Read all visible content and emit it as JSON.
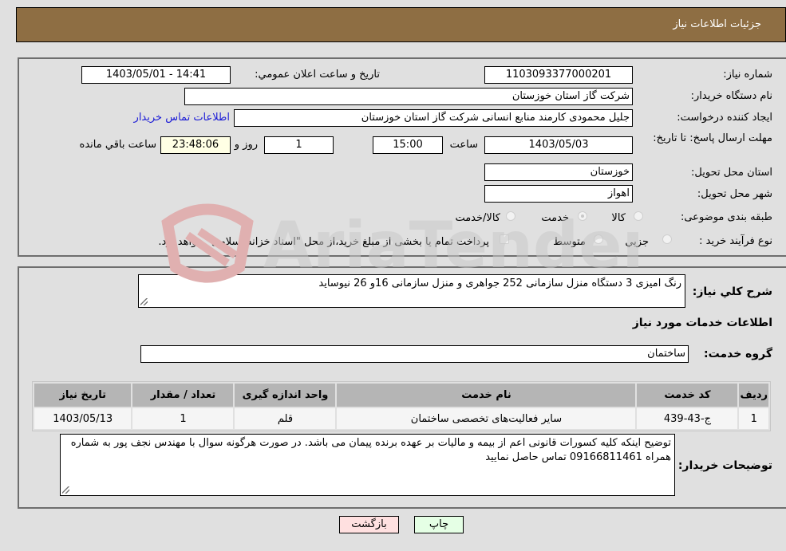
{
  "header": {
    "title": "جزئیات اطلاعات نیاز"
  },
  "form": {
    "need_number_label": "شماره نیاز:",
    "need_number": "1103093377000201",
    "announce_label": "تاریخ و ساعت اعلان عمومي:",
    "announce_value": "1403/05/01 - 14:41",
    "buyer_org_label": "نام دستگاه خریدار:",
    "buyer_org": "شرکت گاز استان خوزستان",
    "requester_label": "ایجاد کننده درخواست:",
    "requester": "جلیل محمودی کارمند منابع انسانی شرکت گاز استان خوزستان",
    "buyer_contact_link": "اطلاعات تماس خریدار",
    "deadline_label": "مهلت ارسال پاسخ: تا تاریخ:",
    "deadline_date": "1403/05/03",
    "time_label": "ساعت",
    "deadline_time": "15:00",
    "days_value": "1",
    "days_label": "روز و",
    "remaining_time": "23:48:06",
    "remaining_label": "ساعت باقي مانده",
    "province_label": "استان محل تحویل:",
    "province": "خوزستان",
    "city_label": "شهر محل تحویل:",
    "city": "اهواز",
    "category_label": "طبقه بندی موضوعی:",
    "category_options": [
      "کالا",
      "خدمت",
      "کالا/خدمت"
    ],
    "category_selected": "خدمت",
    "process_label": "نوع فرآیند خرید :",
    "process_options": [
      "جزيي",
      "متوسط"
    ],
    "treasury_note": "پرداخت تمام یا بخشی از مبلغ خرید،از محل \"اسناد خزانه اسلامی\" خواهد بود."
  },
  "details": {
    "summary_label": "شرح کلي نیاز:",
    "summary": "رنگ امیزی 3 دستگاه منزل سازمانی 252 جواهری و منزل سازمانی 16و 26 نیوساید",
    "services_heading": "اطلاعات خدمات مورد نیاز",
    "service_group_label": "گروه خدمت:",
    "service_group": "ساختمان",
    "table": {
      "headers": [
        "ردیف",
        "کد خدمت",
        "نام خدمت",
        "واحد اندازه گیری",
        "تعداد / مقدار",
        "تاریخ نیاز"
      ],
      "rows": [
        [
          "1",
          "ج-43-439",
          "سایر فعالیت‌های تخصصی ساختمان",
          "قلم",
          "1",
          "1403/05/13"
        ]
      ]
    },
    "buyer_notes_label": "توضیحات خریدار:",
    "buyer_notes": "توضیح اینکه کلیه کسورات قانونی اعم از بیمه و مالیات بر عهده برنده پیمان می باشد. در صورت هرگونه سوال با مهندس نجف پور به شماره همراه 09166811461 تماس حاصل نمایید"
  },
  "buttons": {
    "print": "چاپ",
    "back": "بازگشت"
  },
  "watermark": {
    "text": "AriaTender.neT"
  }
}
